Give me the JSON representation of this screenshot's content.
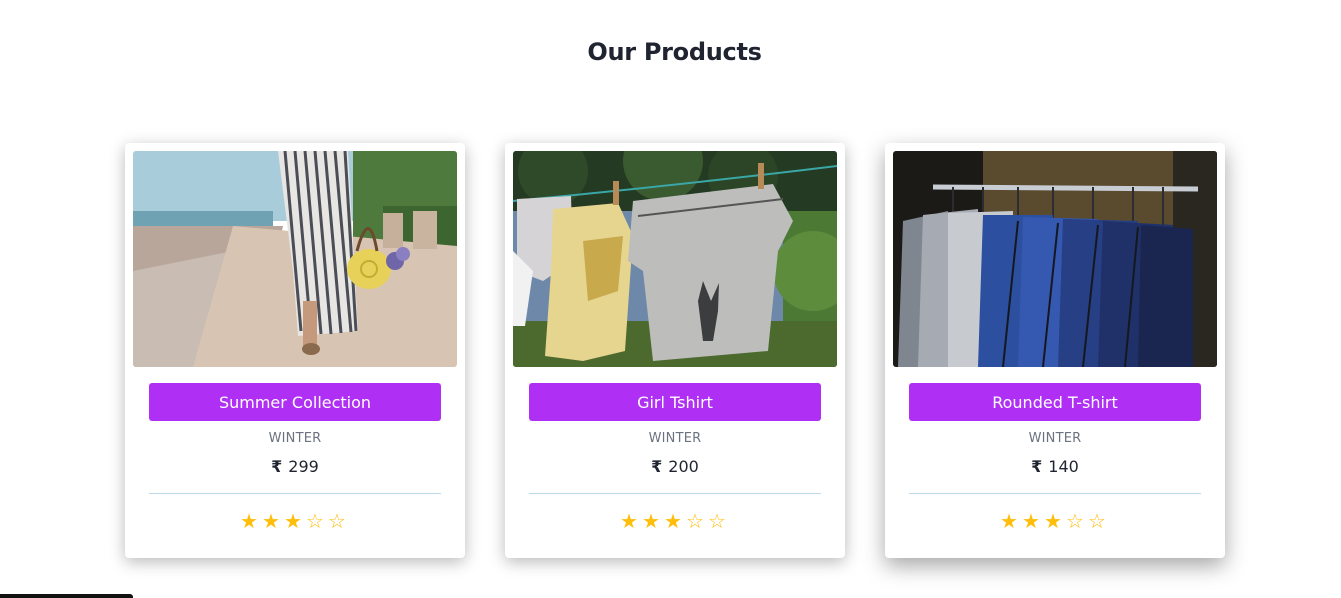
{
  "section": {
    "title": "Our Products"
  },
  "products": [
    {
      "name": "Summer Collection",
      "season": "WINTER",
      "currency": "₹",
      "price": "299",
      "rating": 3,
      "max_rating": 5,
      "image": "woman-walking-striped-dress-photo"
    },
    {
      "name": "Girl Tshirt",
      "season": "WINTER",
      "currency": "₹",
      "price": "200",
      "rating": 3,
      "max_rating": 5,
      "image": "tshirts-on-clothesline-photo"
    },
    {
      "name": "Rounded T-shirt",
      "season": "WINTER",
      "currency": "₹",
      "price": "140",
      "rating": 3,
      "max_rating": 5,
      "image": "suits-on-rack-photo"
    }
  ],
  "colors": {
    "button": "#b02ff5",
    "star": "#ffbe0b",
    "title": "#1f2430"
  }
}
